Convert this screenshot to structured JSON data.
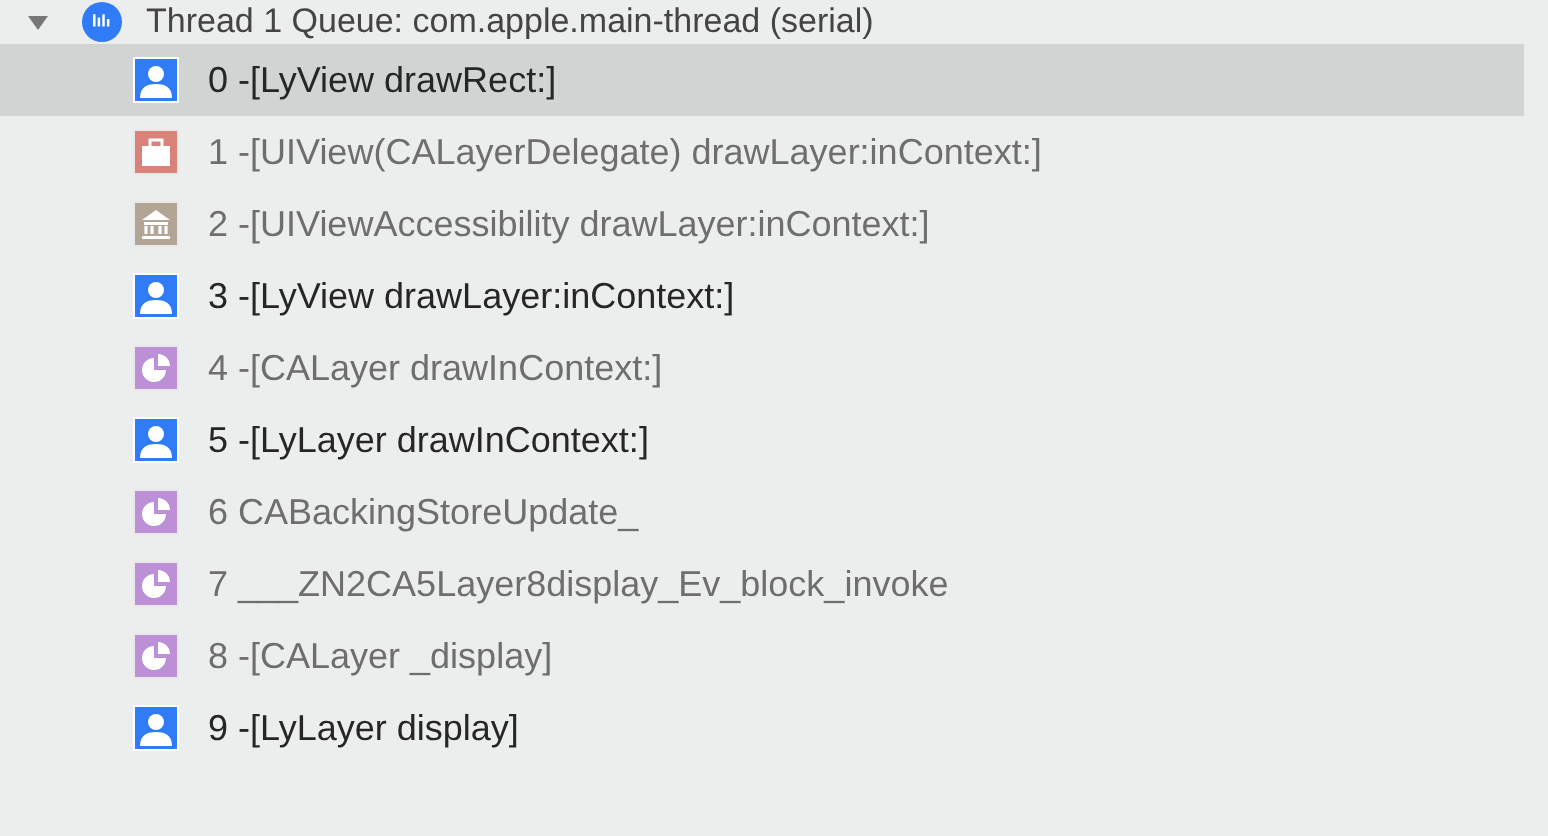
{
  "thread": {
    "label": "Thread 1 Queue: com.apple.main-thread (serial)",
    "expanded": true
  },
  "frames": [
    {
      "label": "0 -[LyView drawRect:]",
      "kind": "user",
      "selected": true
    },
    {
      "label": "1 -[UIView(CALayerDelegate) drawLayer:inContext:]",
      "kind": "uikit",
      "selected": false
    },
    {
      "label": "2 -[UIViewAccessibility drawLayer:inContext:]",
      "kind": "accessibility",
      "selected": false
    },
    {
      "label": "3 -[LyView drawLayer:inContext:]",
      "kind": "user",
      "selected": false
    },
    {
      "label": "4 -[CALayer drawInContext:]",
      "kind": "quartz",
      "selected": false
    },
    {
      "label": "5 -[LyLayer drawInContext:]",
      "kind": "user",
      "selected": false
    },
    {
      "label": "6 CABackingStoreUpdate_",
      "kind": "quartz",
      "selected": false
    },
    {
      "label": "7 ___ZN2CA5Layer8display_Ev_block_invoke",
      "kind": "quartz",
      "selected": false
    },
    {
      "label": "8 -[CALayer _display]",
      "kind": "quartz",
      "selected": false
    },
    {
      "label": "9 -[LyLayer display]",
      "kind": "user",
      "selected": false
    }
  ]
}
